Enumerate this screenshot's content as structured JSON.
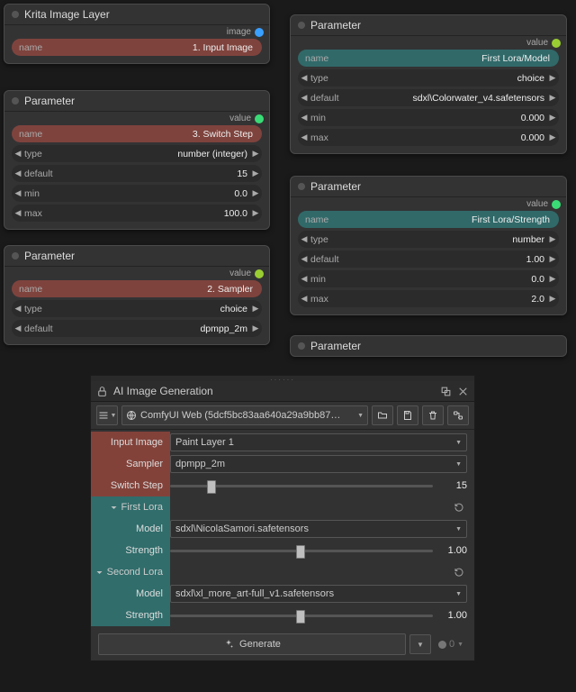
{
  "nodes": {
    "krita": {
      "title": "Krita Image Layer",
      "port_label": "image",
      "name_lbl": "name",
      "name_val": "1. Input Image"
    },
    "switch": {
      "title": "Parameter",
      "port_label": "value",
      "name_lbl": "name",
      "name_val": "3. Switch Step",
      "type_lbl": "type",
      "type_val": "number (integer)",
      "default_lbl": "default",
      "default_val": "15",
      "min_lbl": "min",
      "min_val": "0.0",
      "max_lbl": "max",
      "max_val": "100.0"
    },
    "sampler": {
      "title": "Parameter",
      "port_label": "value",
      "name_lbl": "name",
      "name_val": "2. Sampler",
      "type_lbl": "type",
      "type_val": "choice",
      "default_lbl": "default",
      "default_val": "dpmpp_2m"
    },
    "lora_model": {
      "title": "Parameter",
      "port_label": "value",
      "name_lbl": "name",
      "name_val": "First Lora/Model",
      "type_lbl": "type",
      "type_val": "choice",
      "default_lbl": "default",
      "default_val": "sdxl\\Colorwater_v4.safetensors",
      "min_lbl": "min",
      "min_val": "0.000",
      "max_lbl": "max",
      "max_val": "0.000"
    },
    "lora_strength": {
      "title": "Parameter",
      "port_label": "value",
      "name_lbl": "name",
      "name_val": "First Lora/Strength",
      "type_lbl": "type",
      "type_val": "number",
      "default_lbl": "default",
      "default_val": "1.00",
      "min_lbl": "min",
      "min_val": "0.0",
      "max_lbl": "max",
      "max_val": "2.0"
    },
    "extra": {
      "title": "Parameter"
    }
  },
  "dock": {
    "title": "AI Image Generation",
    "workspace": "ComfyUI Web (5dcf5bc83aa640a29a9bb87…",
    "rows": {
      "input_image_lbl": "Input Image",
      "input_image_val": "Paint Layer 1",
      "sampler_lbl": "Sampler",
      "sampler_val": "dpmpp_2m",
      "switch_lbl": "Switch Step",
      "switch_val": "15",
      "group1": "First Lora",
      "model1_lbl": "Model",
      "model1_val": "sdxl\\NicolaSamori.safetensors",
      "strength1_lbl": "Strength",
      "strength1_val": "1.00",
      "group2": "Second Lora",
      "model2_lbl": "Model",
      "model2_val": "sdxl\\xl_more_art-full_v1.safetensors",
      "strength2_lbl": "Strength",
      "strength2_val": "1.00"
    },
    "generate": "Generate",
    "seed": "0"
  }
}
